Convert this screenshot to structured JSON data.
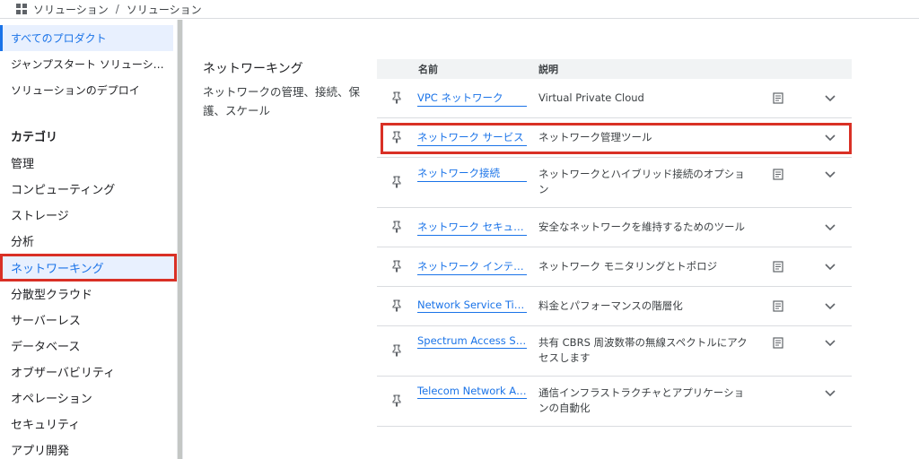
{
  "breadcrumb": {
    "part1": "ソリューション",
    "sep": "/",
    "part2": "ソリューション"
  },
  "sidebar": {
    "top_items": [
      "すべてのプロダクト",
      "ジャンプスタート ソリューシ…",
      "ソリューションのデプロイ"
    ],
    "category_header": "カテゴリ",
    "categories": [
      "管理",
      "コンピューティング",
      "ストレージ",
      "分析",
      "ネットワーキング",
      "分散型クラウド",
      "サーバーレス",
      "データベース",
      "オブザーバビリティ",
      "オペレーション",
      "セキュリティ",
      "アプリ開発"
    ]
  },
  "section": {
    "title": "ネットワーキング",
    "description": "ネットワークの管理、接続、保護、スケール"
  },
  "table": {
    "col_name": "名前",
    "col_desc": "説明",
    "rows": [
      {
        "name": "VPC ネットワーク",
        "desc": "Virtual Private Cloud",
        "doc": true
      },
      {
        "name": "ネットワーク サービス",
        "desc": "ネットワーク管理ツール",
        "doc": false
      },
      {
        "name": "ネットワーク接続",
        "desc": "ネットワークとハイブリッド接続のオプション",
        "doc": true
      },
      {
        "name": "ネットワーク セキュ…",
        "desc": "安全なネットワークを維持するためのツール",
        "doc": false
      },
      {
        "name": "ネットワーク インテ…",
        "desc": "ネットワーク モニタリングとトポロジ",
        "doc": true
      },
      {
        "name": "Network Service Tiers",
        "desc": "料金とパフォーマンスの階層化",
        "doc": true
      },
      {
        "name": "Spectrum Access Syst…",
        "desc": "共有 CBRS 周波数帯の無線スペクトルにアクセスします",
        "doc": true
      },
      {
        "name": "Telecom Network Aut…",
        "desc": "通信インフラストラクチャとアプリケーションの自動化",
        "doc": false
      }
    ]
  },
  "colors": {
    "accent": "#1a73e8",
    "highlight": "#d93025",
    "active_bg": "#e8f0fe"
  },
  "icons": {
    "app": "grid-icon",
    "pin": "pin-icon",
    "doc": "document-icon",
    "expand": "chevron-down-icon"
  }
}
